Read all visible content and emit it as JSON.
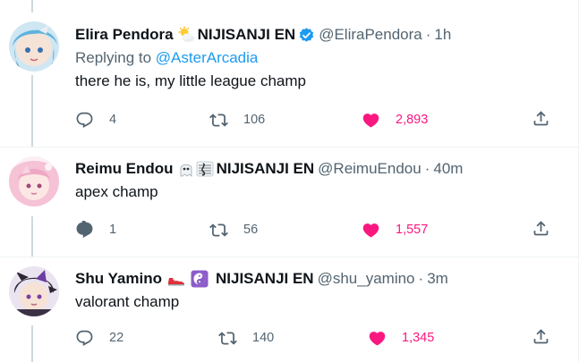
{
  "colors": {
    "like_pink": "#f91880",
    "link_blue": "#1d9bf0",
    "secondary_gray": "#536471",
    "verified_blue": "#1d9bf0"
  },
  "tweets": [
    {
      "name": "Elira Pendora",
      "emoji_icon": "sun-behind-cloud-icon",
      "org": "NIJISANJI EN",
      "verified": true,
      "handle": "@EliraPendora",
      "separator": "·",
      "time": "1h",
      "reply_prefix": "Replying to",
      "reply_mention": "@AsterArcadia",
      "text": "there he is, my little league champ",
      "replies": "4",
      "retweets": "106",
      "likes": "2,893",
      "liked": true
    },
    {
      "name": "Reimu Endou",
      "emoji_icon": "ghost-music-score-icon",
      "org": "NIJISANJI EN",
      "verified": false,
      "handle": "@ReimuEndou",
      "separator": "·",
      "time": "40m",
      "text": "apex champ",
      "replies": "1",
      "retweets": "56",
      "likes": "1,557",
      "liked": true
    },
    {
      "name": "Shu Yamino",
      "emoji_icon": "sneaker-yin-yang-icon",
      "org": "NIJISANJI EN",
      "verified": false,
      "handle": "@shu_yamino",
      "separator": "·",
      "time": "3m",
      "text": "valorant champ",
      "replies": "22",
      "retweets": "140",
      "likes": "1,345",
      "liked": true
    }
  ]
}
